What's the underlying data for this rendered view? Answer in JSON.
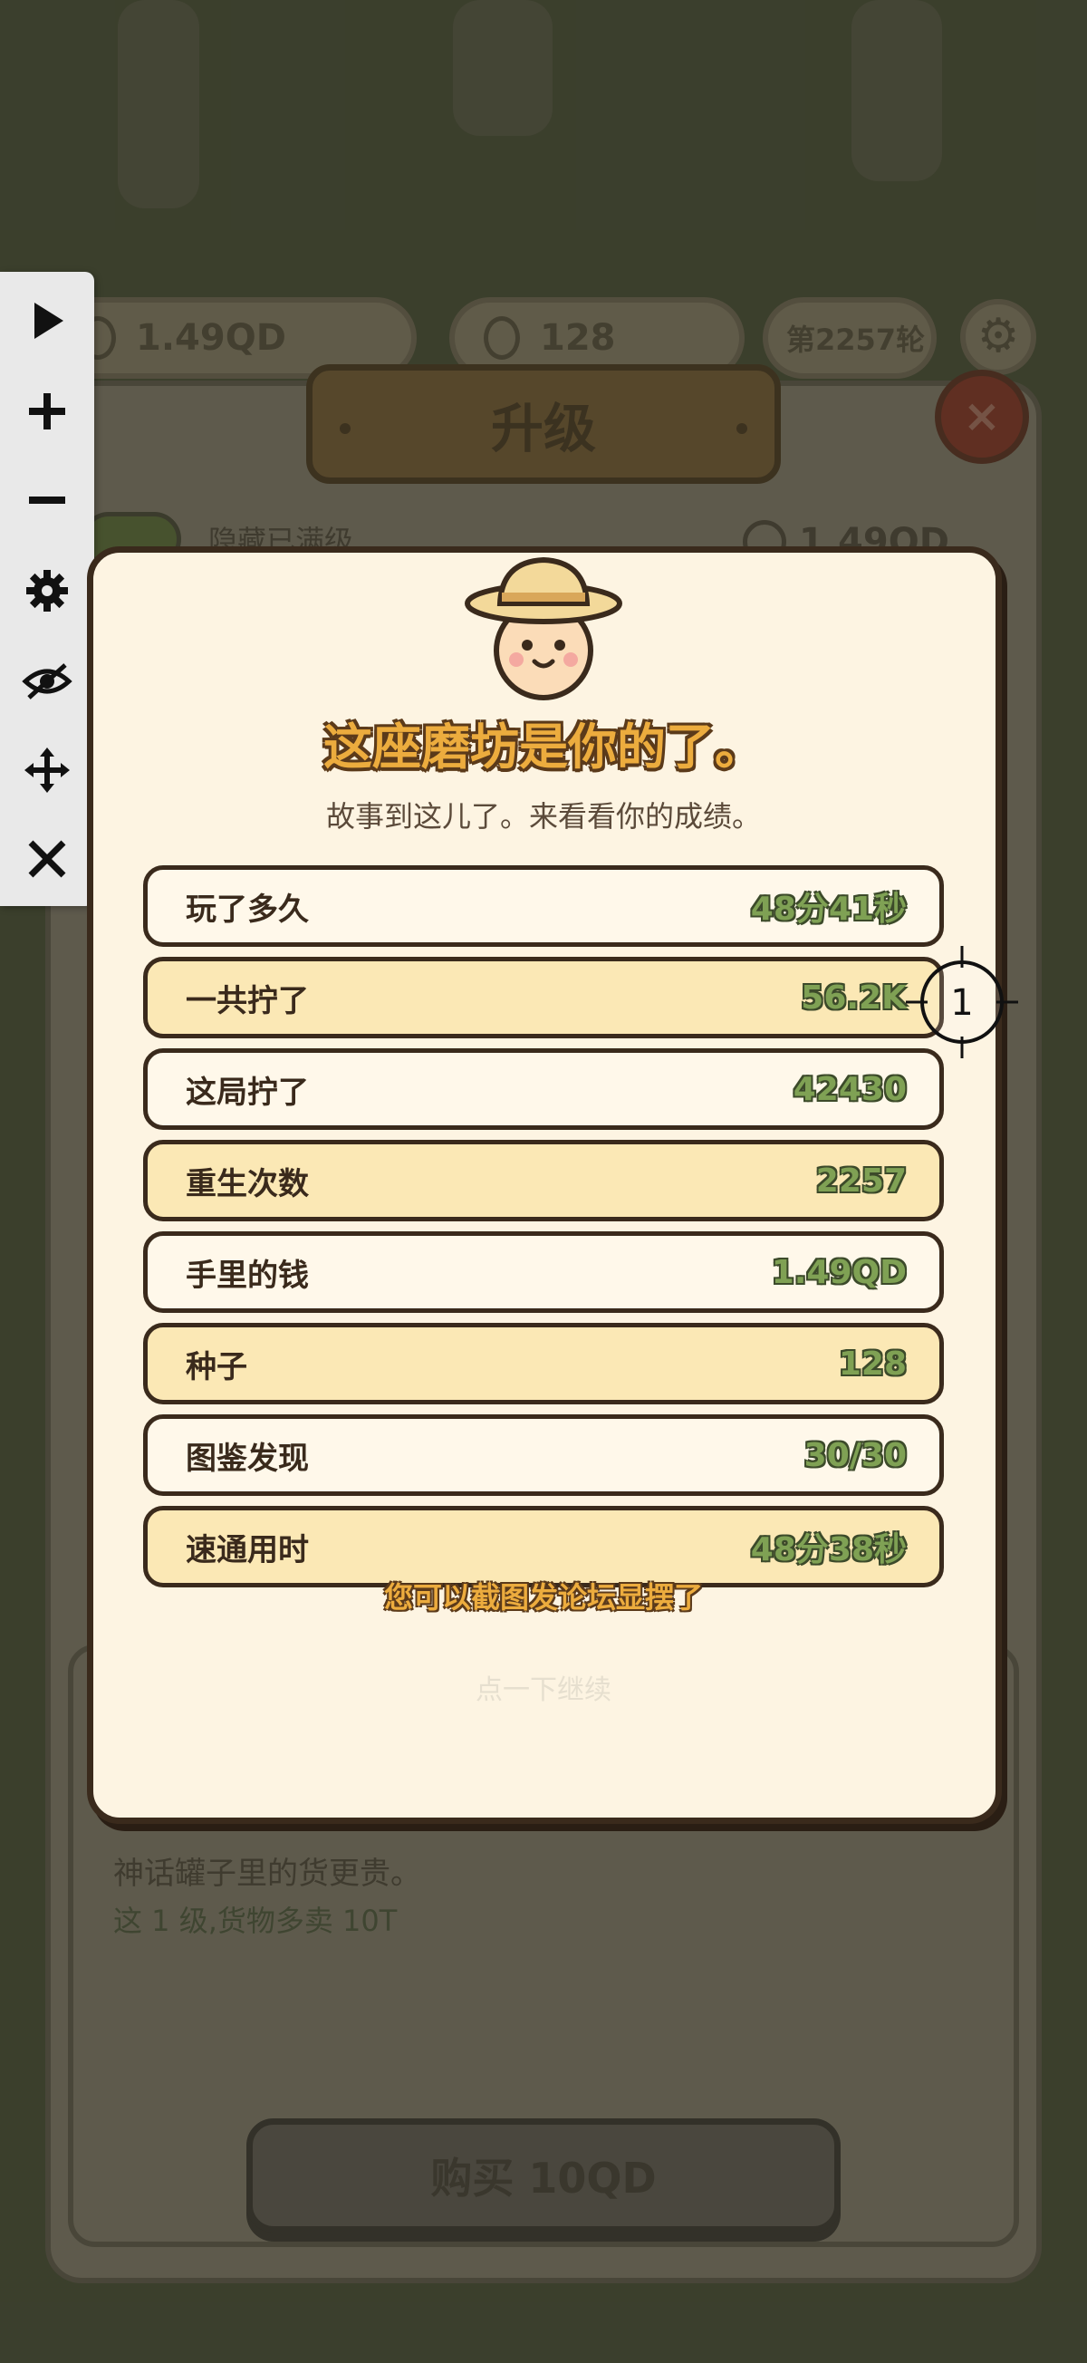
{
  "hud": {
    "money": "1.49QD",
    "seeds": "128",
    "round": "第2257轮"
  },
  "upgrade": {
    "title": "升级",
    "close": "×",
    "hide_maxed": "隐藏已满级",
    "money": "1.49QD",
    "item_description": "神话罐子里的货更贵。",
    "item_effect": "这 1 级,货物多卖 10T",
    "buy_label": "购买 10QD"
  },
  "dialog": {
    "title": "这座磨坊是你的了。",
    "subtitle": "故事到这儿了。来看看你的成绩。",
    "stats": [
      {
        "label": "玩了多久",
        "value": "48分41秒"
      },
      {
        "label": "一共拧了",
        "value": "56.2K"
      },
      {
        "label": "这局拧了",
        "value": "42430"
      },
      {
        "label": "重生次数",
        "value": "2257"
      },
      {
        "label": "手里的钱",
        "value": "1.49QD"
      },
      {
        "label": "种子",
        "value": "128"
      },
      {
        "label": "图鉴发现",
        "value": "30/30"
      },
      {
        "label": "速通用时",
        "value": "48分38秒"
      }
    ],
    "share_hint": "您可以截图发论坛显摆了",
    "continue_hint": "点一下继续"
  },
  "marker": {
    "label": "1"
  },
  "toolbar": {
    "icons": [
      "play-icon",
      "zoom-in-icon",
      "zoom-out-icon",
      "gear-icon",
      "hide-icon",
      "move-icon",
      "close-icon"
    ]
  },
  "colors": {
    "dialog_bg": "#fdf4e2",
    "row_yellow": "#fbe8b5",
    "title_orange": "#ecac3e",
    "value_green": "#7fa154",
    "outline_brown": "#3a2a1c"
  }
}
